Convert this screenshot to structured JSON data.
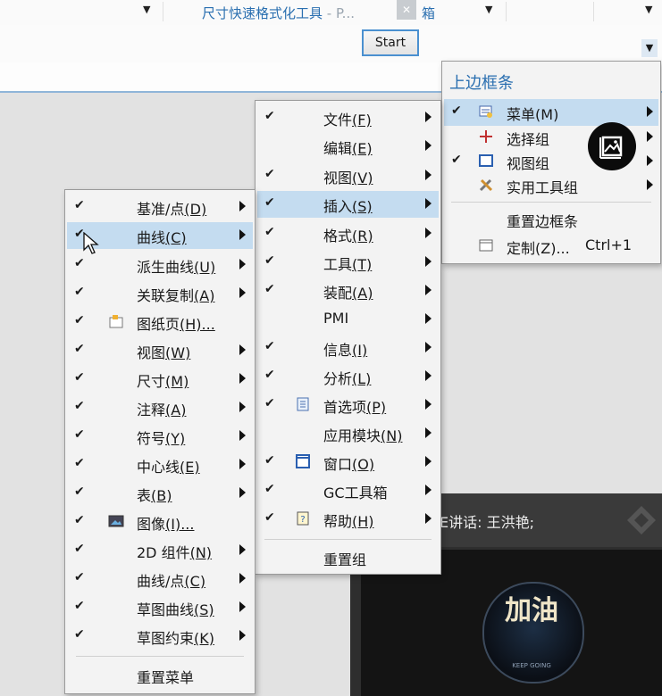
{
  "toolbar": {
    "gc_title": "尺寸快速格式化工具",
    "gc_title_suffix": " - P...",
    "gc_title_tail": "箱",
    "close_glyph": "✕",
    "start_label": "Start"
  },
  "right_menu": {
    "title": "上边框条",
    "items": [
      {
        "label": "菜单",
        "key": "(M)",
        "checked": true,
        "submenu": true,
        "highlight": true,
        "icon": "menu-icon"
      },
      {
        "label": "选择组",
        "checked": false,
        "submenu": true,
        "icon": "selection-icon"
      },
      {
        "label": "视图组",
        "checked": true,
        "submenu": true,
        "icon": "view-icon"
      },
      {
        "label": "实用工具组",
        "checked": false,
        "submenu": true,
        "icon": "tools-icon"
      },
      {
        "label": "重置边框条",
        "checked": false,
        "submenu": false
      },
      {
        "label": "定制",
        "key": "(Z)...",
        "shortcut": "Ctrl+1",
        "checked": false,
        "submenu": false,
        "icon": "customize-icon"
      }
    ]
  },
  "mid_menu": {
    "items": [
      {
        "label": "文件",
        "key": "(F)",
        "checked": true,
        "submenu": true
      },
      {
        "label": "编辑",
        "key": "(E)",
        "checked": false,
        "submenu": true
      },
      {
        "label": "视图",
        "key": "(V)",
        "checked": true,
        "submenu": true
      },
      {
        "label": "插入",
        "key": "(S)",
        "checked": true,
        "submenu": true,
        "highlight": true
      },
      {
        "label": "格式",
        "key": "(R)",
        "checked": true,
        "submenu": true
      },
      {
        "label": "工具",
        "key": "(T)",
        "checked": true,
        "submenu": true
      },
      {
        "label": "装配",
        "key": "(A)",
        "checked": true,
        "submenu": true
      },
      {
        "label": "PMI",
        "checked": false,
        "submenu": true
      },
      {
        "label": "信息",
        "key": "(I)",
        "checked": true,
        "submenu": true
      },
      {
        "label": "分析",
        "key": "(L)",
        "checked": true,
        "submenu": true
      },
      {
        "label": "首选项",
        "key": "(P)",
        "checked": true,
        "submenu": true,
        "icon": "preferences-icon"
      },
      {
        "label": "应用模块",
        "key": "(N)",
        "checked": false,
        "submenu": true
      },
      {
        "label": "窗口",
        "key": "(O)",
        "checked": true,
        "submenu": true,
        "icon": "window-icon"
      },
      {
        "label": "GC工具箱",
        "checked": true,
        "submenu": true
      },
      {
        "label": "帮助",
        "key": "(H)",
        "checked": true,
        "submenu": true,
        "icon": "help-icon"
      },
      {
        "label": "重置组",
        "checked": false,
        "submenu": false
      }
    ]
  },
  "left_menu": {
    "items": [
      {
        "label": "基准/点",
        "key": "(D)",
        "checked": true,
        "submenu": true
      },
      {
        "label": "曲线",
        "key": "(C)",
        "checked": true,
        "submenu": true,
        "highlight": true
      },
      {
        "label": "派生曲线",
        "key": "(U)",
        "checked": true,
        "submenu": true
      },
      {
        "label": "关联复制",
        "key": "(A)",
        "checked": true,
        "submenu": true
      },
      {
        "label": "图纸页",
        "key": "(H)...",
        "checked": true,
        "submenu": false,
        "icon": "drawing-sheet-icon"
      },
      {
        "label": "视图",
        "key": "(W)",
        "checked": true,
        "submenu": true
      },
      {
        "label": "尺寸",
        "key": "(M)",
        "checked": true,
        "submenu": true
      },
      {
        "label": "注释",
        "key": "(A)",
        "checked": true,
        "submenu": true
      },
      {
        "label": "符号",
        "key": "(Y)",
        "checked": true,
        "submenu": true
      },
      {
        "label": "中心线",
        "key": "(E)",
        "checked": true,
        "submenu": true
      },
      {
        "label": "表",
        "key": "(B)",
        "checked": true,
        "submenu": true
      },
      {
        "label": "图像",
        "key": "(I)...",
        "checked": true,
        "submenu": false,
        "icon": "image-icon"
      },
      {
        "label": "2D 组件",
        "key": "(N)",
        "checked": true,
        "submenu": true
      },
      {
        "label": "曲线/点",
        "key": "(C)",
        "checked": true,
        "submenu": true
      },
      {
        "label": "草图曲线",
        "key": "(S)",
        "checked": true,
        "submenu": true
      },
      {
        "label": "草图约束",
        "key": "(K)",
        "checked": true,
        "submenu": true
      },
      {
        "label": "重置菜单",
        "checked": false,
        "submenu": false
      }
    ]
  },
  "video": {
    "speaker": "E讲话: 王洪艳;",
    "badge_text": "加油",
    "badge_sub": "KEEP GOING"
  },
  "check_glyph": "✔"
}
